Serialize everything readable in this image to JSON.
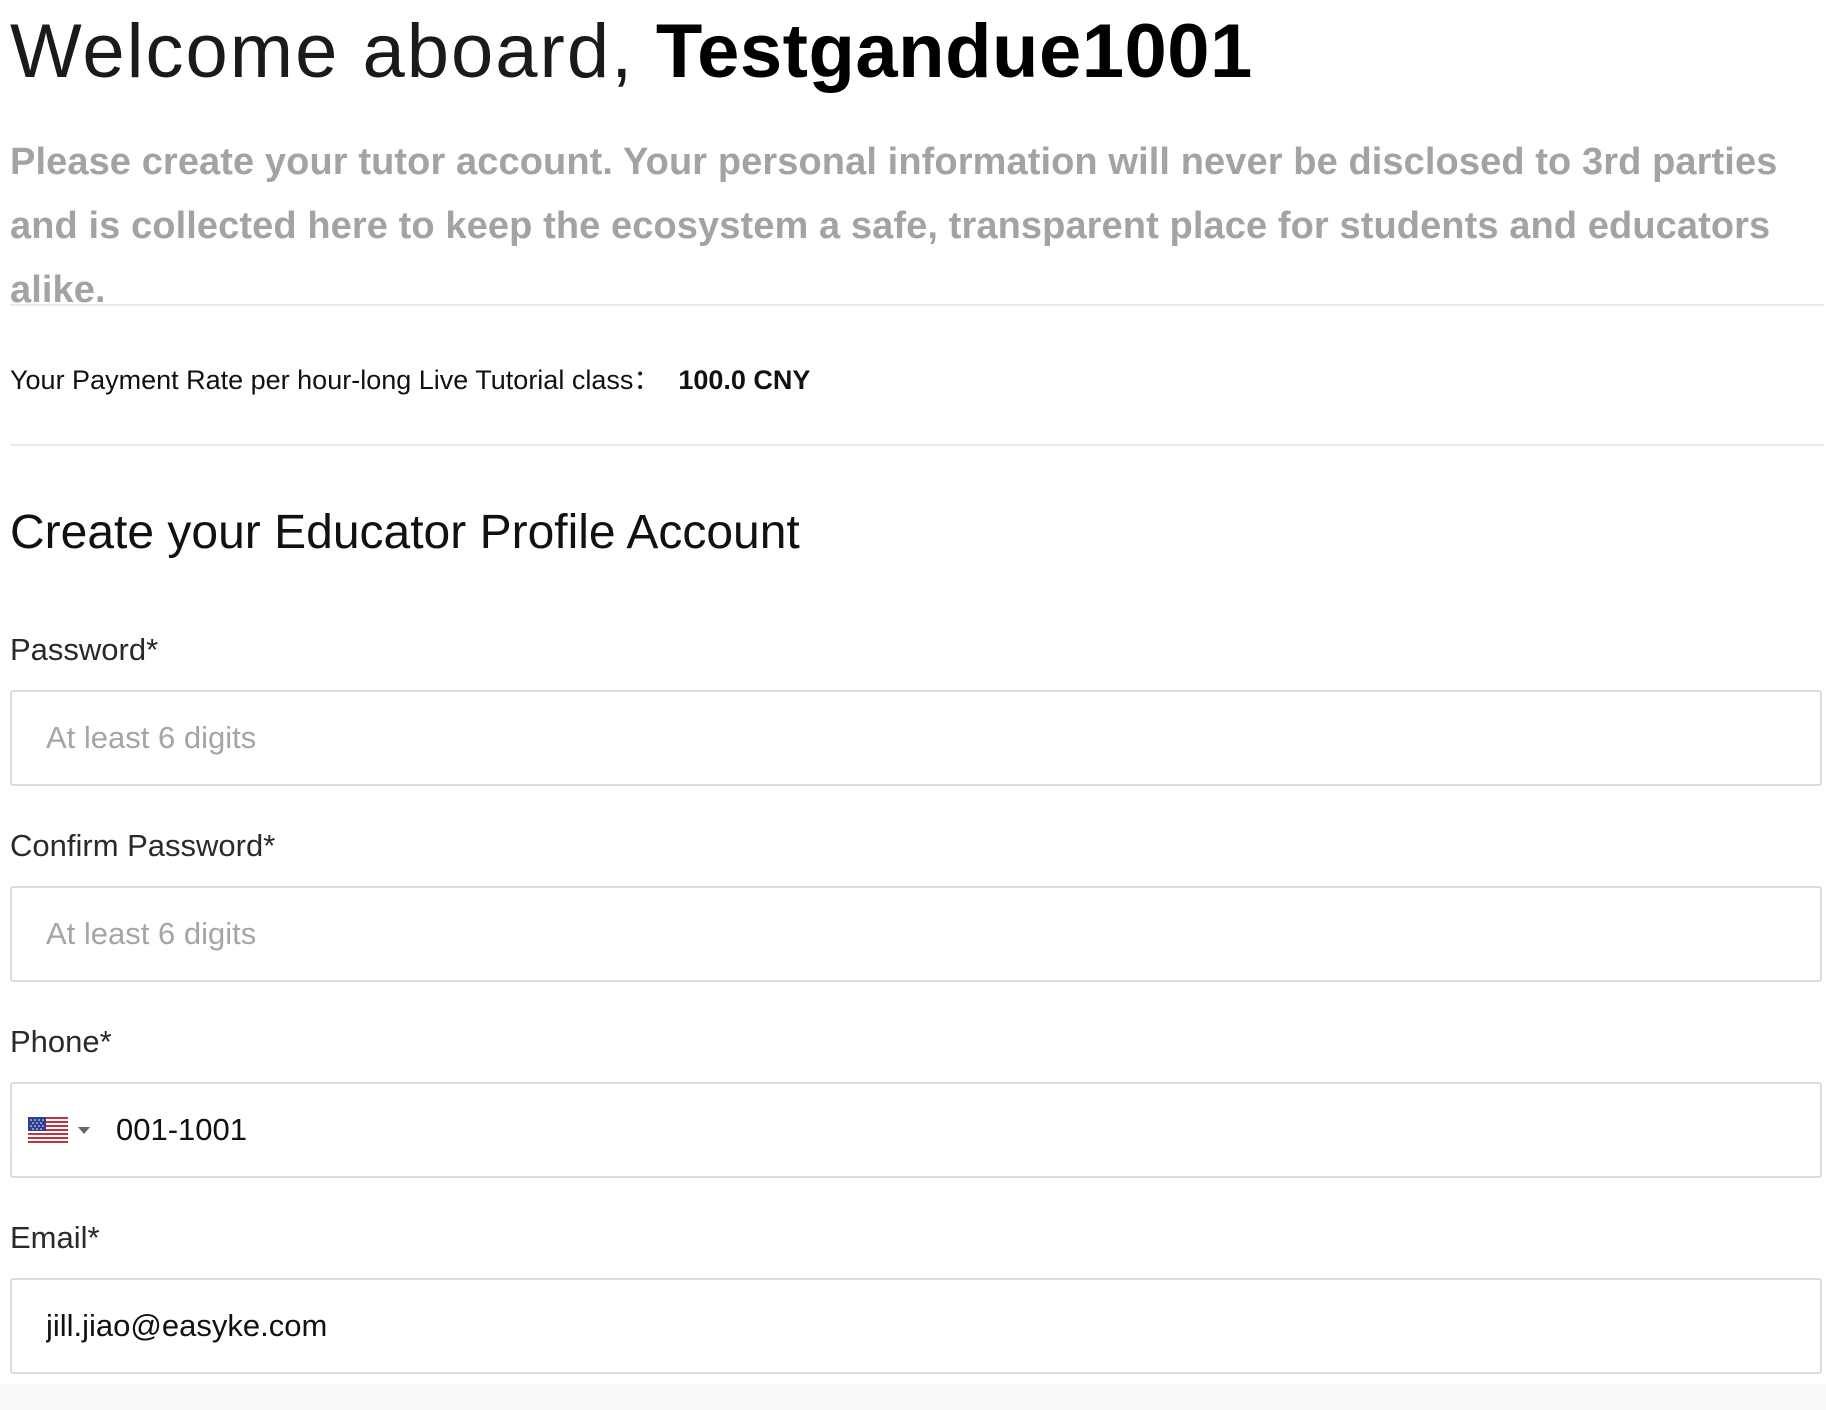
{
  "header": {
    "greeting": "Welcome aboard,",
    "username": "Testgandue1001"
  },
  "intro": "Please create your tutor account. Your personal information will never be disclosed to 3rd parties and is collected here to keep the ecosystem a safe, transparent place for students and educators alike.",
  "payment": {
    "label": "Your Payment Rate per hour-long Live Tutorial class",
    "separator": "：",
    "value": "100.0 CNY"
  },
  "form": {
    "title": "Create your Educator Profile Account",
    "password": {
      "label": "Password*",
      "placeholder": "At least 6 digits",
      "value": ""
    },
    "confirm_password": {
      "label": "Confirm Password*",
      "placeholder": "At least 6 digits",
      "value": ""
    },
    "phone": {
      "label": "Phone*",
      "country_flag_icon": "us-flag-icon",
      "value": "001-1001"
    },
    "email": {
      "label": "Email*",
      "value": "jill.jiao@easyke.com"
    }
  },
  "colors": {
    "intro_text": "#a3a3a3",
    "border": "#dcdcdc",
    "divider": "#eaeaea",
    "placeholder": "#a5a5a5"
  }
}
